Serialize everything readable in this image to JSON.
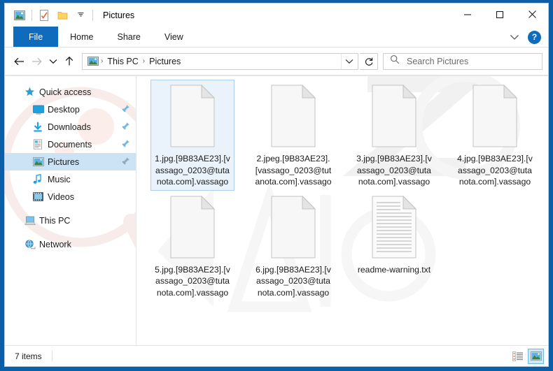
{
  "window": {
    "title": "Pictures",
    "quick_access_icons": [
      "pictures-folder-icon",
      "properties-icon",
      "new-folder-icon",
      "customize-qat-chevron-icon"
    ],
    "controls": {
      "minimize": "minimize-button",
      "maximize": "maximize-button",
      "close": "close-button"
    }
  },
  "ribbon": {
    "tabs": [
      {
        "label": "File",
        "active": true
      },
      {
        "label": "Home",
        "active": false
      },
      {
        "label": "Share",
        "active": false
      },
      {
        "label": "View",
        "active": false
      }
    ],
    "collapse_label": "collapse-ribbon-chevron",
    "help_label": "?"
  },
  "address": {
    "back": "back-arrow",
    "forward": "forward-arrow",
    "recent": "recent-locations-chevron",
    "up": "up-arrow",
    "breadcrumbs": [
      "This PC",
      "Pictures"
    ],
    "separator": "›",
    "dropdown": "address-dropdown-chevron",
    "refresh": "refresh-icon"
  },
  "search": {
    "placeholder": "Search Pictures",
    "icon": "search-icon"
  },
  "sidebar": {
    "items": [
      {
        "label": "Quick access",
        "icon": "star-icon",
        "level": 0,
        "pinned": false,
        "selected": false
      },
      {
        "label": "Desktop",
        "icon": "desktop-icon",
        "level": 1,
        "pinned": true,
        "selected": false
      },
      {
        "label": "Downloads",
        "icon": "downloads-icon",
        "level": 1,
        "pinned": true,
        "selected": false
      },
      {
        "label": "Documents",
        "icon": "documents-icon",
        "level": 1,
        "pinned": true,
        "selected": false
      },
      {
        "label": "Pictures",
        "icon": "pictures-icon",
        "level": 1,
        "pinned": true,
        "selected": true
      },
      {
        "label": "Music",
        "icon": "music-icon",
        "level": 1,
        "pinned": false,
        "selected": false
      },
      {
        "label": "Videos",
        "icon": "videos-icon",
        "level": 1,
        "pinned": false,
        "selected": false
      },
      {
        "label": "This PC",
        "icon": "this-pc-icon",
        "level": 0,
        "pinned": false,
        "selected": false
      },
      {
        "label": "Network",
        "icon": "network-icon",
        "level": 0,
        "pinned": false,
        "selected": false
      }
    ]
  },
  "files": [
    {
      "name": "1.jpg.[9B83AE23].[vassago_0203@tutanota.com].vassago",
      "icon": "blank-file-icon",
      "selected": true
    },
    {
      "name": "2.jpeg.[9B83AE23].[vassago_0203@tutanota.com].vassago",
      "icon": "blank-file-icon",
      "selected": false
    },
    {
      "name": "3.jpg.[9B83AE23].[vassago_0203@tutanota.com].vassago",
      "icon": "blank-file-icon",
      "selected": false
    },
    {
      "name": "4.jpg.[9B83AE23].[vassago_0203@tutanota.com].vassago",
      "icon": "blank-file-icon",
      "selected": false
    },
    {
      "name": "5.jpg.[9B83AE23].[vassago_0203@tutanota.com].vassago",
      "icon": "blank-file-icon",
      "selected": false
    },
    {
      "name": "6.jpg.[9B83AE23].[vassago_0203@tutanota.com].vassago",
      "icon": "blank-file-icon",
      "selected": false
    },
    {
      "name": "readme-warning.txt",
      "icon": "text-file-icon",
      "selected": false
    }
  ],
  "status": {
    "item_count": "7 items",
    "views": [
      {
        "name": "details-view-button",
        "active": false
      },
      {
        "name": "large-icons-view-button",
        "active": true
      }
    ]
  },
  "colors": {
    "accent": "#0f6cbd",
    "window_frame": "#0a5fa8",
    "selection_fill": "#eaf3fb",
    "selection_border": "#aed0ea",
    "sidebar_selection": "#cce3f5"
  }
}
